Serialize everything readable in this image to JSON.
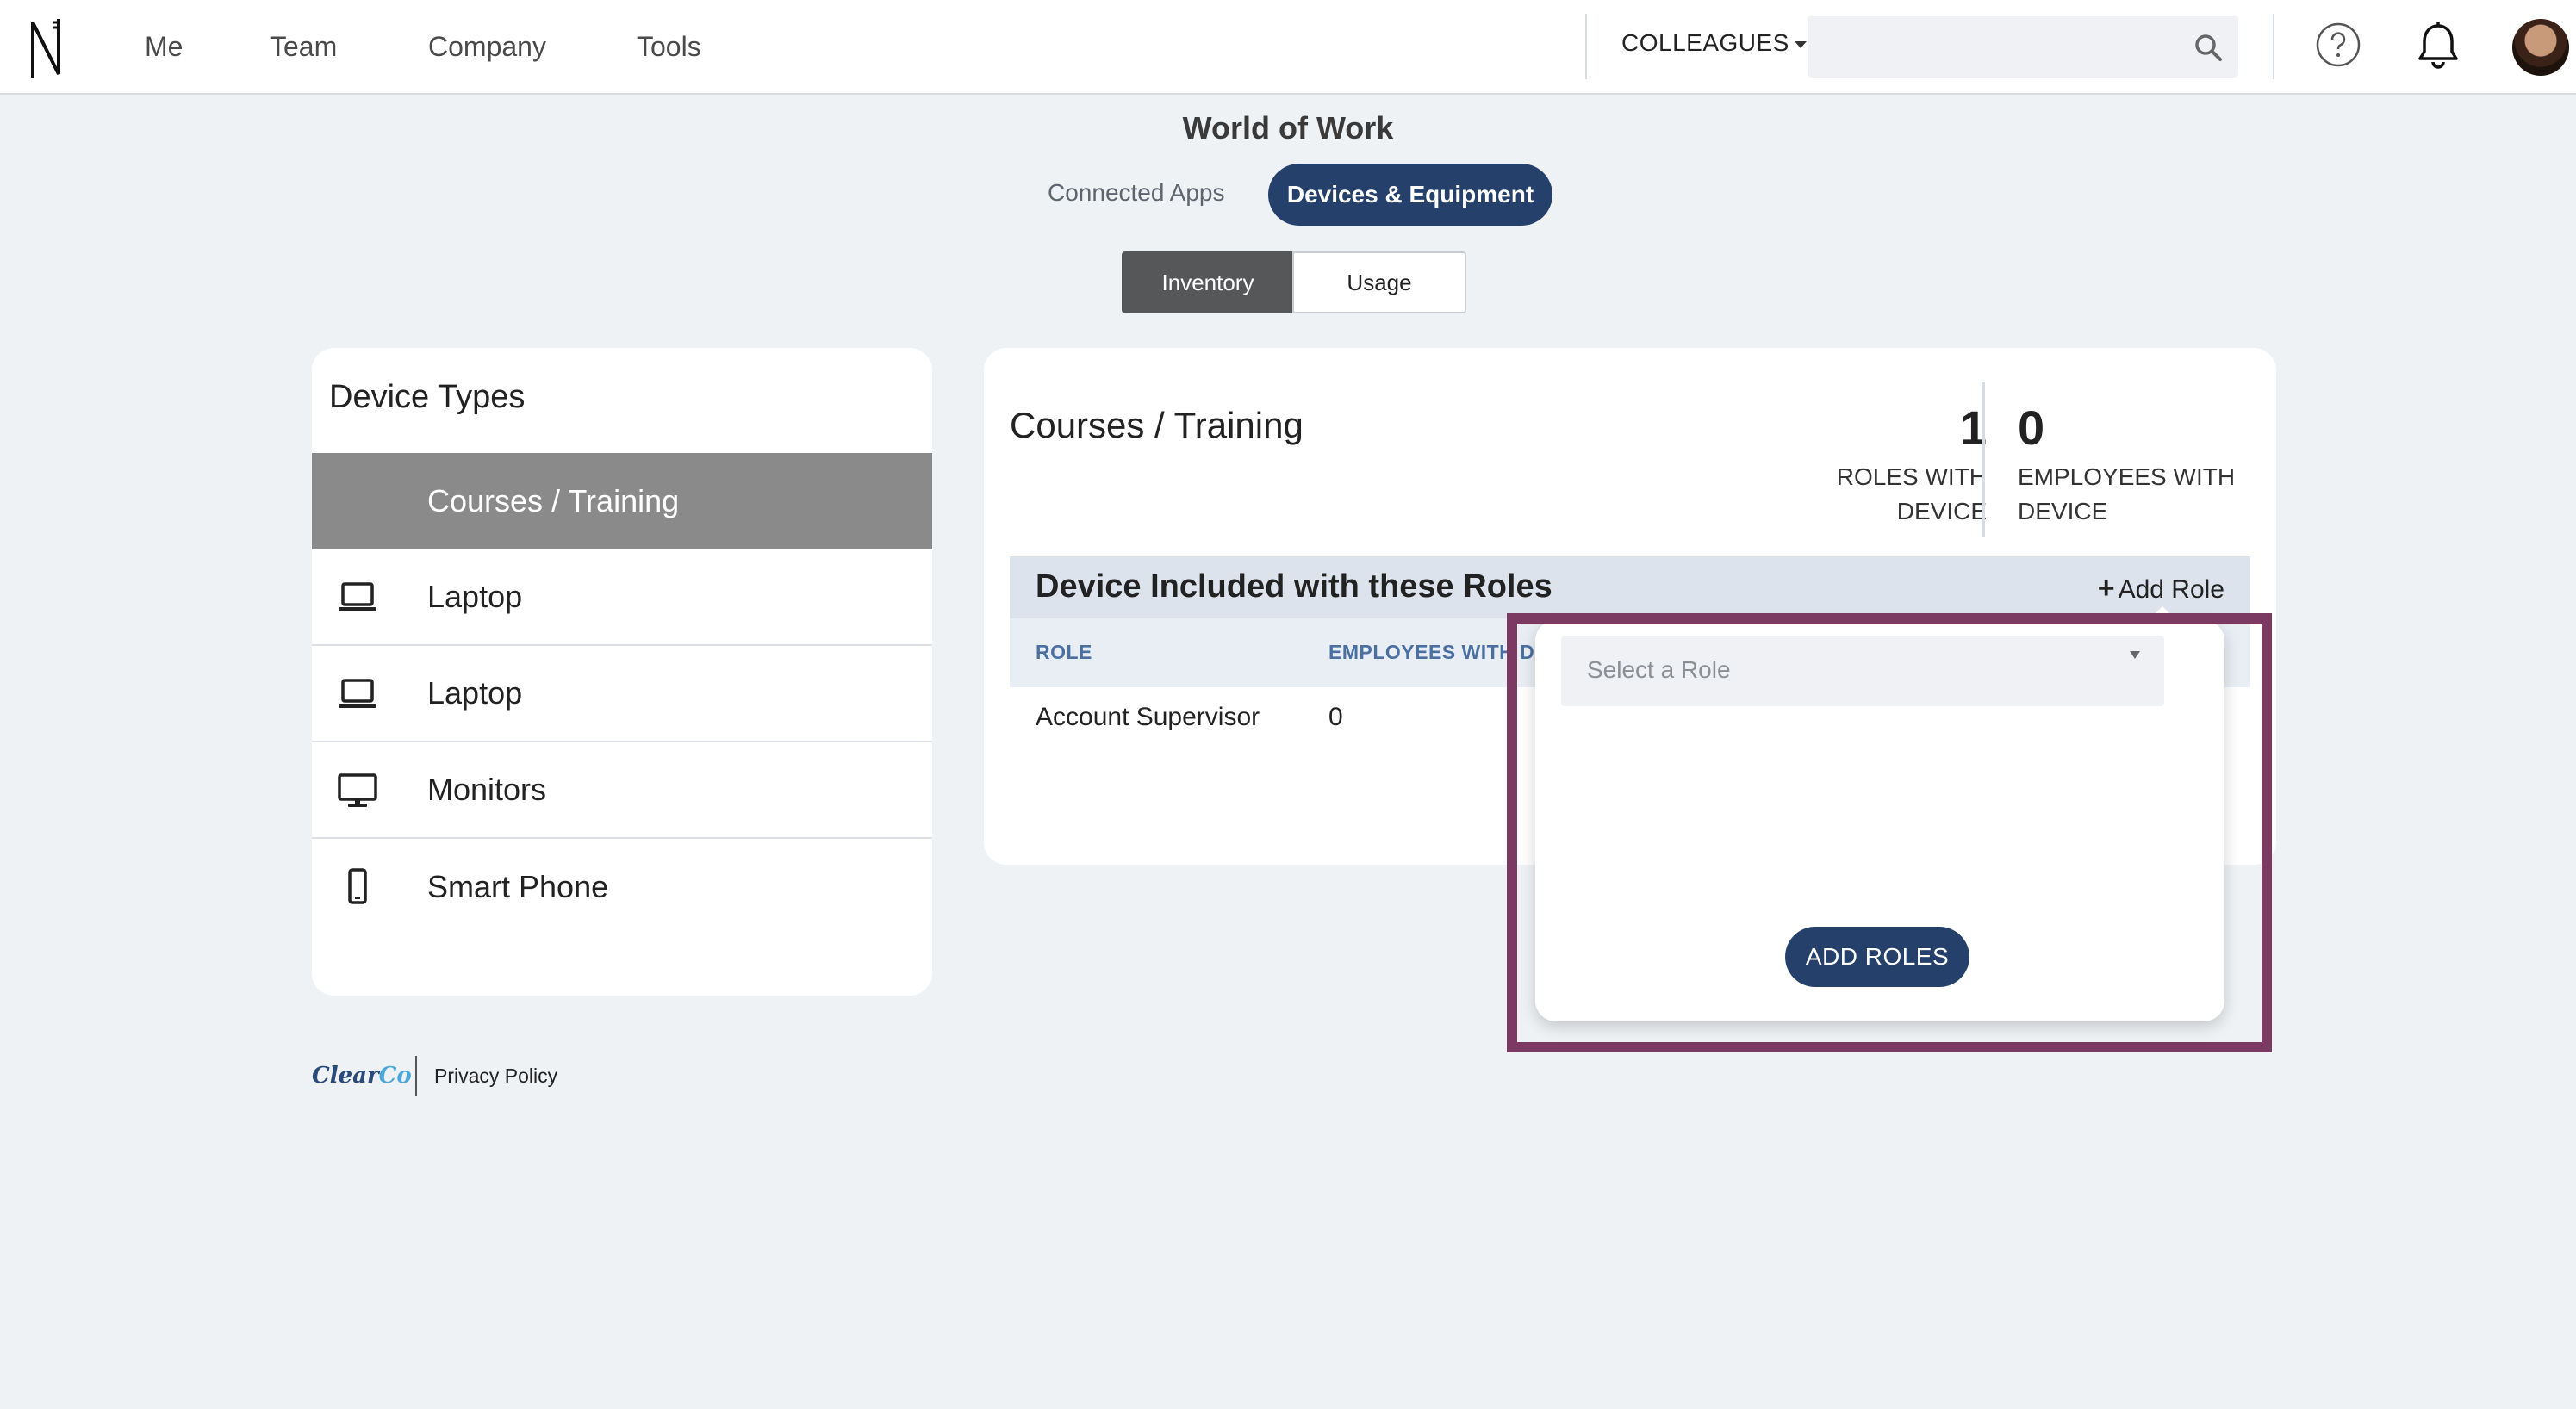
{
  "topbar": {
    "nav": [
      "Me",
      "Team",
      "Company",
      "Tools"
    ],
    "colleagues_label": "COLLEAGUES",
    "search": {
      "value": "",
      "placeholder": ""
    }
  },
  "page": {
    "title": "World of Work",
    "tabs": [
      "Connected Apps",
      "Devices & Equipment"
    ],
    "active_tab": "Devices & Equipment",
    "segments": [
      "Inventory",
      "Usage"
    ],
    "active_segment": "Inventory"
  },
  "device_types": {
    "title": "Device Types",
    "items": [
      {
        "label": "Courses / Training",
        "icon": "none",
        "active": true
      },
      {
        "label": "Laptop",
        "icon": "laptop-icon"
      },
      {
        "label": "Laptop",
        "icon": "laptop-icon"
      },
      {
        "label": "Monitors",
        "icon": "monitor-icon"
      },
      {
        "label": "Smart Phone",
        "icon": "phone-icon"
      }
    ]
  },
  "detail": {
    "title": "Courses / Training",
    "stats": [
      {
        "value": "1",
        "label_line1": "ROLES WITH",
        "label_line2": "DEVICE"
      },
      {
        "value": "0",
        "label_line1": "EMPLOYEES WITH",
        "label_line2": "DEVICE"
      }
    ],
    "roles_section": {
      "title": "Device Included with these Roles",
      "add_role_label": "Add Role",
      "columns": [
        "ROLE",
        "EMPLOYEES WITH DEVICE"
      ],
      "rows": [
        {
          "role": "Account Supervisor",
          "employees": "0"
        }
      ]
    }
  },
  "popover": {
    "select_placeholder": "Select a Role",
    "button_label": "ADD ROLES"
  },
  "footer": {
    "logo_part1": "Clear",
    "logo_part2": "Co",
    "link": "Privacy Policy"
  },
  "colors": {
    "primary": "#25406b",
    "highlight": "#7a3a62",
    "active_item": "#8a8a8a",
    "background": "#eff2f5"
  }
}
